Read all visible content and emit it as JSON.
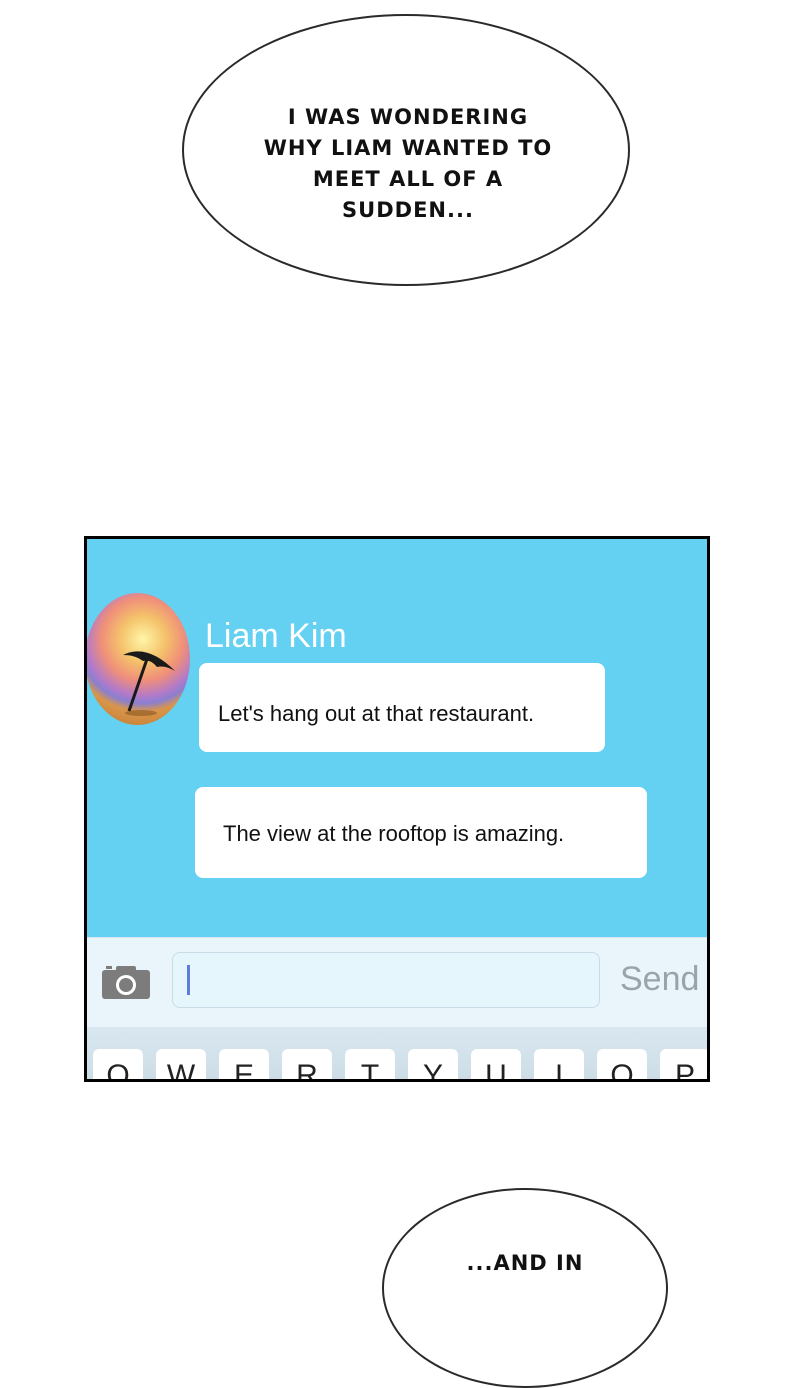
{
  "bubble_top": {
    "lines": [
      "I WAS WONDERING",
      "WHY LIAM WANTED TO",
      "MEET ALL OF A",
      "SUDDEN..."
    ]
  },
  "chat": {
    "contact_name": "Liam Kim",
    "messages": [
      "Let's hang out at that restaurant.",
      "The view at the rooftop is amazing."
    ],
    "input_value": "",
    "send_label": "Send",
    "keyboard_keys": [
      "Q",
      "W",
      "E",
      "R",
      "T",
      "Y",
      "U",
      "I",
      "O",
      "P"
    ],
    "colors": {
      "chat_background": "#64d1f2",
      "bubble": "#ffffff",
      "send": "#9aa3a8"
    },
    "icons": {
      "camera": "camera-icon",
      "avatar": "beach-umbrella-avatar"
    }
  },
  "bubble_bottom": {
    "text": "...AND IN"
  }
}
